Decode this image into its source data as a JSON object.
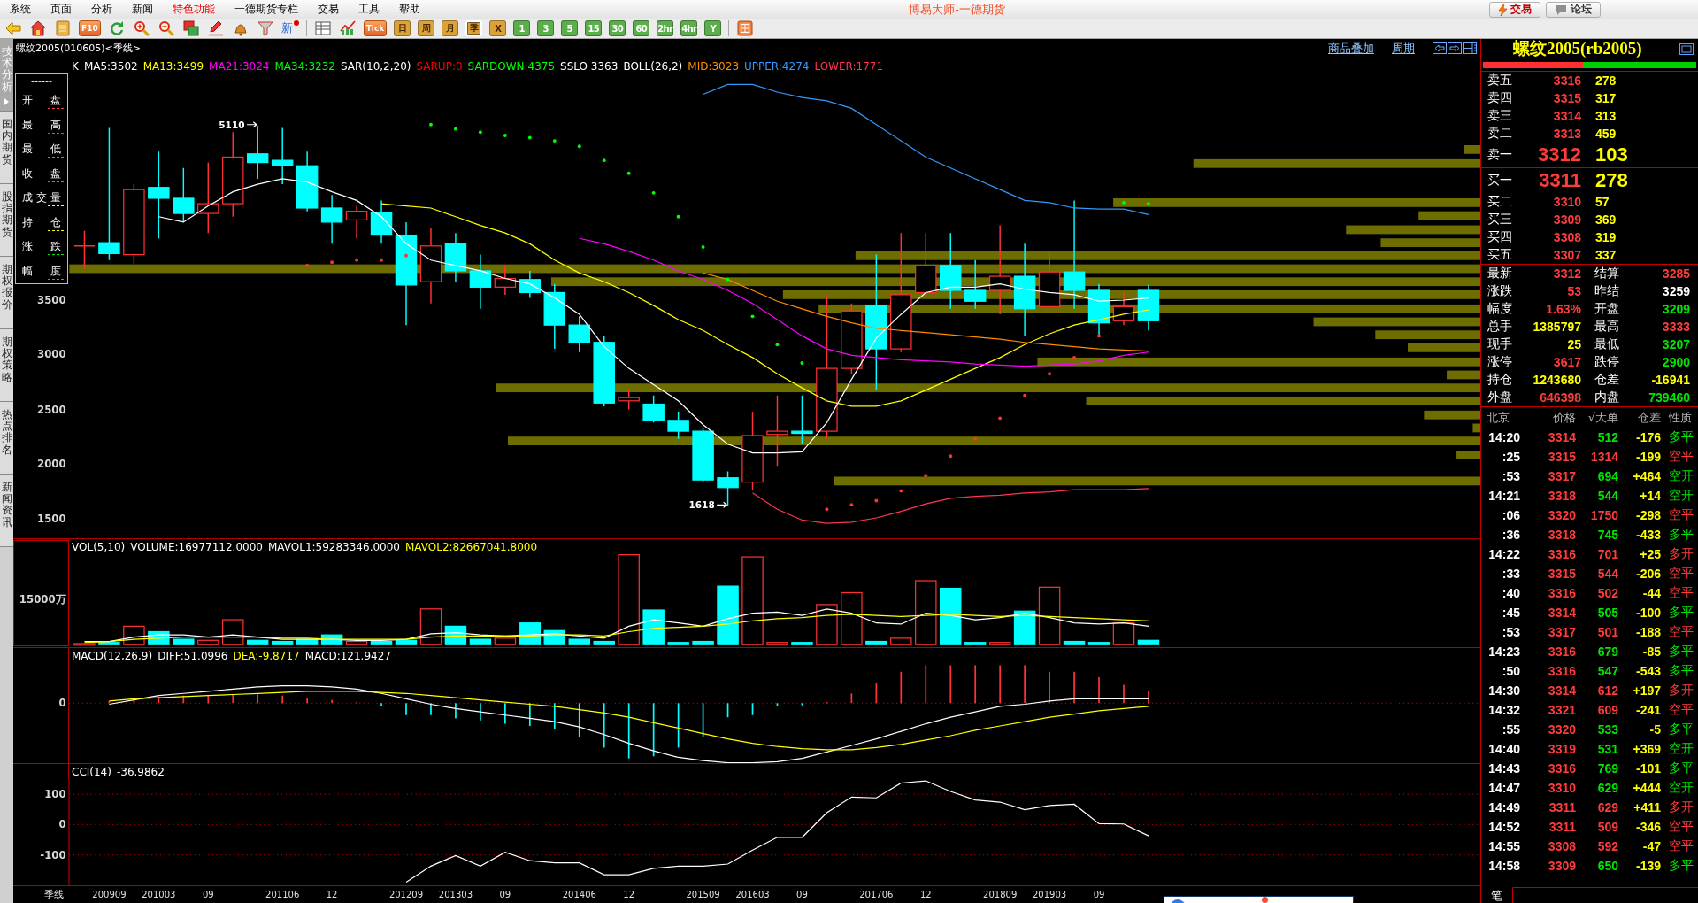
{
  "menu": {
    "items": [
      {
        "label": "系统",
        "highlighted": false
      },
      {
        "label": "页面",
        "highlighted": false
      },
      {
        "label": "分析",
        "highlighted": false
      },
      {
        "label": "新闻",
        "highlighted": false
      },
      {
        "label": "特色功能",
        "highlighted": true
      },
      {
        "label": "一德期货专栏",
        "highlighted": false
      },
      {
        "label": "交易",
        "highlighted": false
      },
      {
        "label": "工具",
        "highlighted": false
      },
      {
        "label": "帮助",
        "highlighted": false
      }
    ],
    "title": "博易大师-一德期货",
    "buttons": [
      {
        "label": "交易",
        "kind": "trade"
      },
      {
        "label": "论坛",
        "kind": "forum"
      }
    ]
  },
  "toolbar": {
    "text_buttons": [
      {
        "label": "F10",
        "kind": "tile"
      },
      {
        "label": "新",
        "kind": "plain"
      },
      {
        "label": "Tick",
        "kind": "tile"
      }
    ],
    "periods": [
      {
        "label": "日",
        "color": "#d9a23a",
        "selected": false
      },
      {
        "label": "周",
        "color": "#d9a23a",
        "selected": false
      },
      {
        "label": "月",
        "color": "#d9a23a",
        "selected": false
      },
      {
        "label": "季",
        "color": "#d9a23a",
        "selected": true
      },
      {
        "label": "X",
        "color": "#d9a23a",
        "selected": false
      },
      {
        "label": "1",
        "color": "#5cae4c",
        "selected": false
      },
      {
        "label": "3",
        "color": "#5cae4c",
        "selected": false
      },
      {
        "label": "5",
        "color": "#5cae4c",
        "selected": false
      },
      {
        "label": "15",
        "color": "#5cae4c",
        "selected": false
      },
      {
        "label": "30",
        "color": "#5cae4c",
        "selected": false
      },
      {
        "label": "60",
        "color": "#5cae4c",
        "selected": false
      },
      {
        "label": "2hr",
        "color": "#5cae4c",
        "selected": false
      },
      {
        "label": "4hr",
        "color": "#5cae4c",
        "selected": false
      },
      {
        "label": "Y",
        "color": "#5cae4c",
        "selected": false
      }
    ]
  },
  "side_tabs": [
    {
      "label": "技术分析",
      "selected": true
    },
    {
      "label": "国内期货",
      "selected": false
    },
    {
      "label": "股指期货",
      "selected": false
    },
    {
      "label": "期权报价",
      "selected": false
    },
    {
      "label": "期权策略",
      "selected": false
    },
    {
      "label": "热点排名",
      "selected": false
    },
    {
      "label": "新闻资讯",
      "selected": false
    }
  ],
  "chart": {
    "title": "螺纹2005(010605)<季线>",
    "links": [
      "商品叠加",
      "周期"
    ],
    "price": {
      "indicators": [
        {
          "text": "K",
          "color": "#ffffff"
        },
        {
          "text": "MA5:3502",
          "color": "#ffffff"
        },
        {
          "text": "MA13:3499",
          "color": "#ffff00"
        },
        {
          "text": "MA21:3024",
          "color": "#ff00ff"
        },
        {
          "text": "MA34:3232",
          "color": "#00ff00"
        },
        {
          "text": "SAR(10,2,20)",
          "color": "#ffffff"
        },
        {
          "text": "SARUP:0",
          "color": "#ff0000"
        },
        {
          "text": "SARDOWN:4375",
          "color": "#00ff00"
        },
        {
          "text": "SSLO 3363",
          "color": "#ffffff"
        },
        {
          "text": "BOLL(26,2)",
          "color": "#ffffff"
        },
        {
          "text": "MID:3023",
          "color": "#ff8c00"
        },
        {
          "text": "UPPER:4274",
          "color": "#3399ff"
        },
        {
          "text": "LOWER:1771",
          "color": "#ff3355"
        }
      ],
      "legend_title": "------",
      "legend": [
        {
          "label": "开盘",
          "color": "#ff3c3c"
        },
        {
          "label": "最高",
          "color": "#ff3c3c"
        },
        {
          "label": "最低",
          "color": "#00e600"
        },
        {
          "label": "收盘",
          "color": "#00e600"
        },
        {
          "label": "成交量",
          "color": "#ffff00"
        },
        {
          "label": "持仓",
          "color": "#ffff00"
        },
        {
          "label": "涨跌",
          "color": "#00e600"
        },
        {
          "label": "幅度",
          "color": "#00e600"
        }
      ],
      "axis": [
        "3500",
        "3000",
        "2500",
        "2000",
        "1500"
      ],
      "annotations": [
        "5110",
        "1618"
      ]
    },
    "volume": {
      "indicators": [
        {
          "text": "VOL(5,10)",
          "color": "#ffffff"
        },
        {
          "text": "VOLUME:16977112.0000",
          "color": "#ffffff"
        },
        {
          "text": "MAVOL1:59283346.0000",
          "color": "#ffffff"
        },
        {
          "text": "MAVOL2:82667041.8000",
          "color": "#ffff00"
        }
      ],
      "axis": "15000万"
    },
    "macd": {
      "indicators": [
        {
          "text": "MACD(12,26,9)",
          "color": "#ffffff"
        },
        {
          "text": "DIFF:51.0996",
          "color": "#ffffff"
        },
        {
          "text": "DEA:-9.8717",
          "color": "#ffff00"
        },
        {
          "text": "MACD:121.9427",
          "color": "#ffffff"
        }
      ],
      "axis": "0"
    },
    "cci": {
      "value": "-36.9862",
      "chart_data": {
        "type": "line",
        "ylim": [
          -200,
          150
        ],
        "yticks": [
          100,
          0,
          -100
        ],
        "grid": true,
        "series": [
          {
            "name": "CCI(14)",
            "color": "#ffffff",
            "values": [
              null,
              null,
              null,
              null,
              null,
              null,
              null,
              null,
              null,
              null,
              null,
              null,
              null,
              -190,
              -137,
              -102,
              -137,
              -91,
              -119,
              -126,
              -126,
              -165,
              -165,
              -144,
              -137,
              -137,
              -130,
              -84,
              -42,
              -42,
              39,
              91,
              88,
              137,
              144,
              109,
              81,
              74,
              49,
              63,
              67,
              3,
              2,
              -37
            ]
          }
        ]
      }
    },
    "time_axis": {
      "label": "季线",
      "ticks": [
        "200909",
        "201003",
        "09",
        "201106",
        "12",
        "201209",
        "201303",
        "09",
        "201406",
        "12",
        "201509",
        "201603",
        "09",
        "201706",
        "12",
        "201809",
        "201903",
        "09"
      ]
    }
  },
  "quote": {
    "title": "螺纹2005(rb2005)",
    "ratio": {
      "level": 0.47
    },
    "asks": [
      {
        "label": "卖五",
        "price": "3316",
        "volume": "278"
      },
      {
        "label": "卖四",
        "price": "3315",
        "volume": "317"
      },
      {
        "label": "卖三",
        "price": "3314",
        "volume": "313"
      },
      {
        "label": "卖二",
        "price": "3313",
        "volume": "459"
      },
      {
        "label": "卖一",
        "price": "3312",
        "volume": "103"
      }
    ],
    "bids": [
      {
        "label": "买一",
        "price": "3311",
        "volume": "278"
      },
      {
        "label": "买二",
        "price": "3310",
        "volume": "57"
      },
      {
        "label": "买三",
        "price": "3309",
        "volume": "369"
      },
      {
        "label": "买四",
        "price": "3308",
        "volume": "319"
      },
      {
        "label": "买五",
        "price": "3307",
        "volume": "337"
      }
    ],
    "stats": [
      {
        "label": "最新",
        "value": "3312",
        "color": "#ff3c3c"
      },
      {
        "label": "结算",
        "value": "3285",
        "color": "#ff3c3c"
      },
      {
        "label": "涨跌",
        "value": "53",
        "color": "#ff3c3c"
      },
      {
        "label": "昨结",
        "value": "3259",
        "color": "#ffffff"
      },
      {
        "label": "幅度",
        "value": "1.63%",
        "color": "#ff3c3c"
      },
      {
        "label": "开盘",
        "value": "3209",
        "color": "#00e600"
      },
      {
        "label": "总手",
        "value": "1385797",
        "color": "#ffff00"
      },
      {
        "label": "最高",
        "value": "3333",
        "color": "#ff3c3c"
      },
      {
        "label": "现手",
        "value": "25",
        "color": "#ffff00"
      },
      {
        "label": "最低",
        "value": "3207",
        "color": "#00e600"
      },
      {
        "label": "涨停",
        "value": "3617",
        "color": "#ff3c3c"
      },
      {
        "label": "跌停",
        "value": "2900",
        "color": "#00e600"
      },
      {
        "label": "持仓",
        "value": "1243680",
        "color": "#ffff00"
      },
      {
        "label": "仓差",
        "value": "-16941",
        "color": "#ffff00"
      },
      {
        "label": "外盘",
        "value": "646398",
        "color": "#ff3c3c"
      },
      {
        "label": "内盘",
        "value": "739460",
        "color": "#00e600"
      }
    ],
    "trades": {
      "columns": [
        "北京",
        "价格",
        "√大单",
        "仓差",
        "性质"
      ],
      "rows": [
        {
          "time": "14:20",
          "price": "3314",
          "volume": "512",
          "change": "-176",
          "type": "多平",
          "color": "#00e600"
        },
        {
          "time": ":25",
          "price": "3315",
          "volume": "1314",
          "change": "-199",
          "type": "空平",
          "color": "#ff3c3c"
        },
        {
          "time": ":53",
          "price": "3317",
          "volume": "694",
          "change": "+464",
          "type": "空开",
          "color": "#00e600"
        },
        {
          "time": "14:21",
          "price": "3318",
          "volume": "544",
          "change": "+14",
          "type": "空开",
          "color": "#00e600"
        },
        {
          "time": ":06",
          "price": "3320",
          "volume": "1750",
          "change": "-298",
          "type": "空平",
          "color": "#ff3c3c"
        },
        {
          "time": ":36",
          "price": "3318",
          "volume": "745",
          "change": "-433",
          "type": "多平",
          "color": "#00e600"
        },
        {
          "time": "14:22",
          "price": "3316",
          "volume": "701",
          "change": "+25",
          "type": "多开",
          "color": "#ff3c3c"
        },
        {
          "time": ":33",
          "price": "3315",
          "volume": "544",
          "change": "-206",
          "type": "空平",
          "color": "#ff3c3c"
        },
        {
          "time": ":40",
          "price": "3316",
          "volume": "502",
          "change": "-44",
          "type": "空平",
          "color": "#ff3c3c"
        },
        {
          "time": ":45",
          "price": "3314",
          "volume": "505",
          "change": "-100",
          "type": "多平",
          "color": "#00e600"
        },
        {
          "time": ":53",
          "price": "3317",
          "volume": "501",
          "change": "-188",
          "type": "空平",
          "color": "#ff3c3c"
        },
        {
          "time": "14:23",
          "price": "3316",
          "volume": "679",
          "change": "-85",
          "type": "多平",
          "color": "#00e600"
        },
        {
          "time": ":50",
          "price": "3316",
          "volume": "547",
          "change": "-543",
          "type": "多平",
          "color": "#00e600"
        },
        {
          "time": "14:30",
          "price": "3314",
          "volume": "612",
          "change": "+197",
          "type": "多开",
          "color": "#ff3c3c"
        },
        {
          "time": "14:32",
          "price": "3321",
          "volume": "609",
          "change": "-241",
          "type": "空平",
          "color": "#ff3c3c"
        },
        {
          "time": ":55",
          "price": "3320",
          "volume": "533",
          "change": "-5",
          "type": "多平",
          "color": "#00e600"
        },
        {
          "time": "14:40",
          "price": "3319",
          "volume": "531",
          "change": "+369",
          "type": "空开",
          "color": "#00e600"
        },
        {
          "time": "14:43",
          "price": "3316",
          "volume": "769",
          "change": "-101",
          "type": "多平",
          "color": "#00e600"
        },
        {
          "time": "14:47",
          "price": "3310",
          "volume": "629",
          "change": "+444",
          "type": "空开",
          "color": "#00e600"
        },
        {
          "time": "14:49",
          "price": "3311",
          "volume": "629",
          "change": "+411",
          "type": "多开",
          "color": "#ff3c3c"
        },
        {
          "time": "14:52",
          "price": "3311",
          "volume": "509",
          "change": "-346",
          "type": "空平",
          "color": "#ff3c3c"
        },
        {
          "time": "14:55",
          "price": "3308",
          "volume": "592",
          "change": "-47",
          "type": "空平",
          "color": "#ff3c3c"
        },
        {
          "time": "14:58",
          "price": "3309",
          "volume": "650",
          "change": "-139",
          "type": "多平",
          "color": "#00e600"
        }
      ]
    },
    "tabs": [
      {
        "label": "笔",
        "selected": true
      }
    ]
  }
}
